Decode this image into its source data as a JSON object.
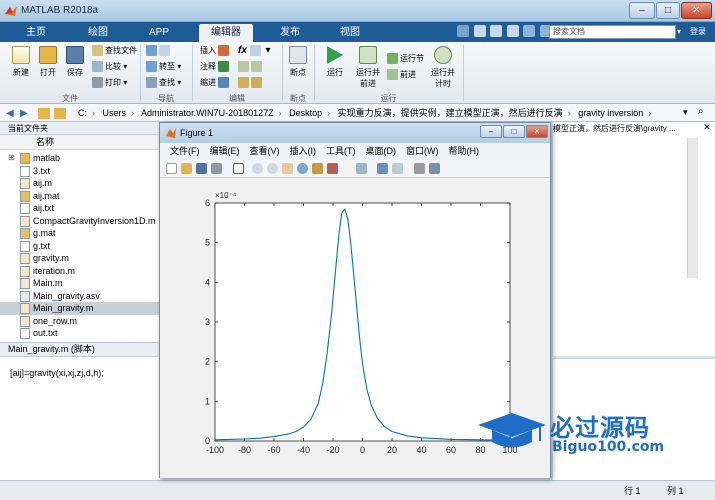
{
  "window": {
    "title": "MATLAB R2018a"
  },
  "tabs": [
    {
      "label": "主页"
    },
    {
      "label": "绘图"
    },
    {
      "label": "APP"
    },
    {
      "label": "编辑器"
    },
    {
      "label": "发布"
    },
    {
      "label": "视图"
    }
  ],
  "search": {
    "placeholder": "搜索文档",
    "submit_label": "登录"
  },
  "ribbon": {
    "file": {
      "new": "新建",
      "open": "打开",
      "save": "保存",
      "find_files": "查找文件",
      "compare": "比较",
      "print": "打印",
      "group": "文件"
    },
    "nav": {
      "goto": "转至",
      "find": "查找",
      "group": "导航"
    },
    "edit": {
      "insert": "插入",
      "comment": "注释",
      "indent": "缩进",
      "fx": "fx",
      "group": "编辑"
    },
    "breakpoints": {
      "label": "断点",
      "group": "断点"
    },
    "run": {
      "run": "运行",
      "run_advance_1": "运行并",
      "run_advance_2": "前进",
      "run_section": "运行节",
      "advance": "前进",
      "run_time_1": "运行并",
      "run_time_2": "计时",
      "group": "运行"
    }
  },
  "address": {
    "segments": [
      "C:",
      "Users",
      "Administrator.WIN7U-20180127Z",
      "Desktop",
      "实现重力反演，提供实例，建立模型正演，然后进行反演",
      "gravity inversion"
    ]
  },
  "files": {
    "header": "当前文件夹",
    "column": "名称",
    "items": [
      {
        "name": "matlab",
        "type": "folder"
      },
      {
        "name": "3.txt",
        "type": "txt"
      },
      {
        "name": "aij.m",
        "type": "m"
      },
      {
        "name": "aij.mat",
        "type": "mat"
      },
      {
        "name": "aij.txt",
        "type": "txt"
      },
      {
        "name": "CompactGravityInversion1D.m",
        "type": "m"
      },
      {
        "name": "g.mat",
        "type": "mat"
      },
      {
        "name": "g.txt",
        "type": "txt"
      },
      {
        "name": "gravity.m",
        "type": "m"
      },
      {
        "name": "iteration.m",
        "type": "m"
      },
      {
        "name": "Main.m",
        "type": "m"
      },
      {
        "name": "Main_gravity.asv",
        "type": "asv"
      },
      {
        "name": "Main_gravity.m",
        "type": "m",
        "selected": true
      },
      {
        "name": "one_row.m",
        "type": "m"
      },
      {
        "name": "out.txt",
        "type": "txt"
      }
    ],
    "details_title": "Main_gravity.m  (脚本)",
    "details_code": "[aij]=gravity(xi,xj,zj,d,h);"
  },
  "editor": {
    "path": "模型正演，然后进行反演\\gravity ..."
  },
  "status": {
    "line_label": "行 1",
    "col_label": "列 1"
  },
  "figure": {
    "title": "Figure 1",
    "menus": [
      "文件(F)",
      "编辑(E)",
      "查看(V)",
      "插入(I)",
      "工具(T)",
      "桌面(D)",
      "窗口(W)",
      "帮助(H)"
    ]
  },
  "chart_data": {
    "type": "line",
    "title": "",
    "xlabel": "",
    "ylabel": "",
    "y_scale_label": "×10⁻⁴",
    "xlim": [
      -100,
      100
    ],
    "ylim": [
      0,
      6
    ],
    "xticks": [
      -100,
      -80,
      -60,
      -40,
      -20,
      0,
      20,
      40,
      60,
      80,
      100
    ],
    "yticks": [
      0,
      1,
      2,
      3,
      4,
      5,
      6
    ],
    "grid": false,
    "series": [
      {
        "color": "#0072bd",
        "x": [
          -100,
          -90,
          -80,
          -70,
          -60,
          -50,
          -45,
          -40,
          -35,
          -30,
          -27,
          -24,
          -21,
          -18,
          -16,
          -14,
          -12,
          -10,
          -8,
          -6,
          -4,
          -2,
          0,
          3,
          6,
          10,
          15,
          20,
          30,
          40,
          50,
          60,
          70,
          80,
          90,
          100
        ],
        "values": [
          0.03,
          0.04,
          0.05,
          0.07,
          0.11,
          0.18,
          0.24,
          0.35,
          0.55,
          0.95,
          1.45,
          2.2,
          3.2,
          4.4,
          5.2,
          5.75,
          5.85,
          5.6,
          5.0,
          4.2,
          3.4,
          2.6,
          1.95,
          1.3,
          0.9,
          0.58,
          0.36,
          0.24,
          0.13,
          0.08,
          0.06,
          0.04,
          0.035,
          0.03,
          0.025,
          0.02
        ]
      }
    ]
  },
  "watermark": {
    "cn": "必过源码",
    "en": "Biguo100.com"
  }
}
